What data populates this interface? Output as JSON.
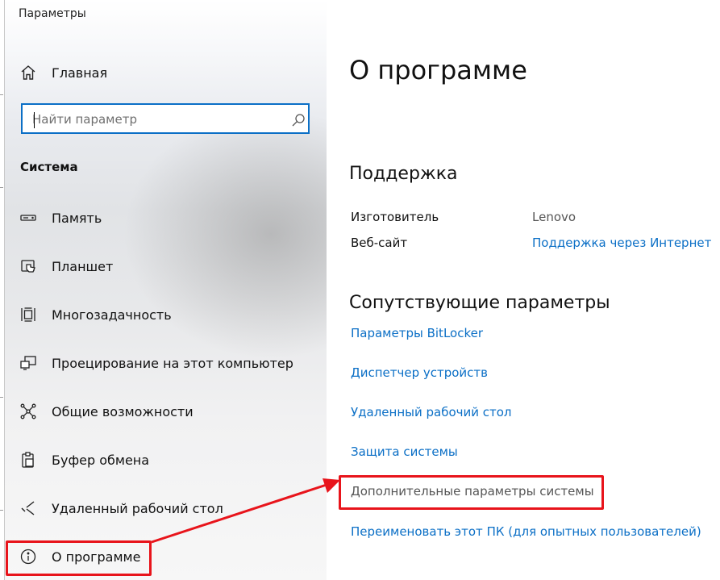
{
  "window": {
    "title": "Параметры"
  },
  "sidebar": {
    "home_label": "Главная",
    "search_placeholder": "Найти параметр",
    "section_title": "Система",
    "items": [
      {
        "label": "Память",
        "icon": "storage-icon"
      },
      {
        "label": "Планшет",
        "icon": "tablet-icon"
      },
      {
        "label": "Многозадачность",
        "icon": "multitasking-icon"
      },
      {
        "label": "Проецирование на этот компьютер",
        "icon": "projecting-icon"
      },
      {
        "label": "Общие возможности",
        "icon": "shared-experiences-icon"
      },
      {
        "label": "Буфер обмена",
        "icon": "clipboard-icon"
      },
      {
        "label": "Удаленный рабочий стол",
        "icon": "remote-desktop-icon"
      },
      {
        "label": "О программе",
        "icon": "info-icon",
        "selected": true
      }
    ]
  },
  "content": {
    "title": "О программе",
    "support": {
      "heading": "Поддержка",
      "manufacturer_label": "Изготовитель",
      "manufacturer_value": "Lenovo",
      "website_label": "Веб-сайт",
      "website_link": "Поддержка через Интернет"
    },
    "related": {
      "heading": "Сопутствующие параметры",
      "links": [
        "Параметры BitLocker",
        "Диспетчер устройств",
        "Удаленный рабочий стол",
        "Защита системы",
        "Дополнительные параметры системы",
        "Переименовать этот ПК (для опытных пользователей)"
      ]
    }
  },
  "colors": {
    "accent": "#0b6fc6",
    "annotation": "#e8141b"
  }
}
